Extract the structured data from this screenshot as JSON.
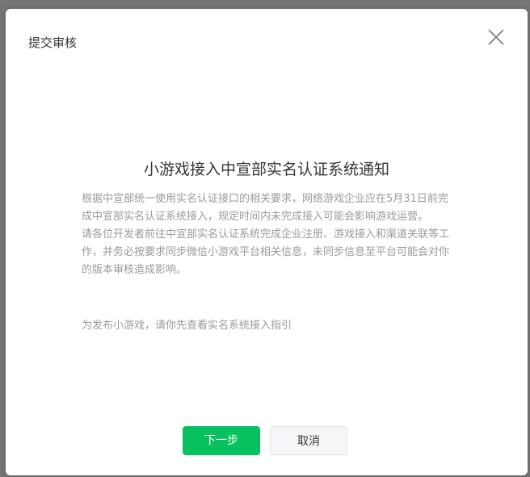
{
  "dialog": {
    "title": "提交审核",
    "close_icon": "close-icon"
  },
  "notice": {
    "heading": "小游戏接入中宣部实名认证系统通知",
    "paragraph_1": "根据中宣部统一使用实名认证接口的相关要求，网络游戏企业应在5月31日前完成中宣部实名认证系统接入，规定时间内未完成接入可能会影响游戏运营。",
    "paragraph_2": "请各位开发者前往中宣部实名认证系统完成企业注册、游戏接入和渠道关联等工作，并务必按要求同步微信小游戏平台相关信息，未同步信息至平台可能会对你的版本审核造成影响。",
    "guide_text": "为发布小游戏，请你先查看实名系统接入指引"
  },
  "buttons": {
    "next_label": "下一步",
    "cancel_label": "取消"
  },
  "colors": {
    "primary": "#07c160",
    "title_text": "#353535",
    "body_text": "#9a9a9a",
    "overlay": "#767676"
  }
}
